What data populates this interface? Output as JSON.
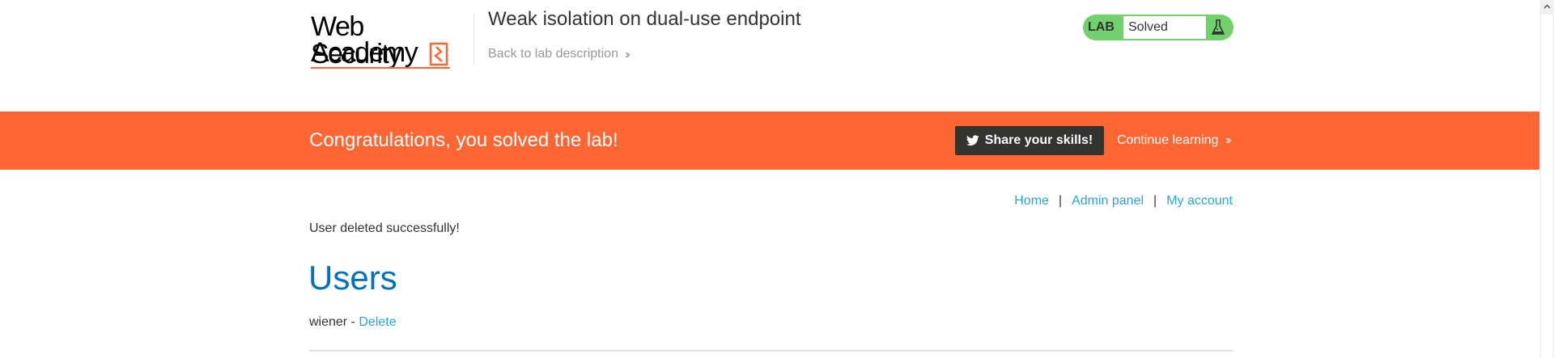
{
  "header": {
    "logo_line1": "Web Security",
    "logo_line2": "Academy",
    "lab_title": "Weak isolation on dual-use endpoint",
    "back_link": "Back to lab description",
    "lab_tag": "LAB",
    "lab_status": "Solved"
  },
  "banner": {
    "message": "Congratulations, you solved the lab!",
    "share_button": "Share your skills!",
    "continue_link": "Continue learning"
  },
  "nav": {
    "items": [
      "Home",
      "Admin panel",
      "My account"
    ],
    "separator": "|"
  },
  "main": {
    "message": "User deleted successfully!",
    "heading": "Users",
    "users": [
      {
        "name": "wiener",
        "separator": " - ",
        "action": "Delete"
      }
    ]
  },
  "colors": {
    "brand_orange": "#ff6633",
    "link_blue": "#29a3db",
    "heading_blue": "#0071bc",
    "lab_green": "#70d16d",
    "dark": "#333332"
  }
}
